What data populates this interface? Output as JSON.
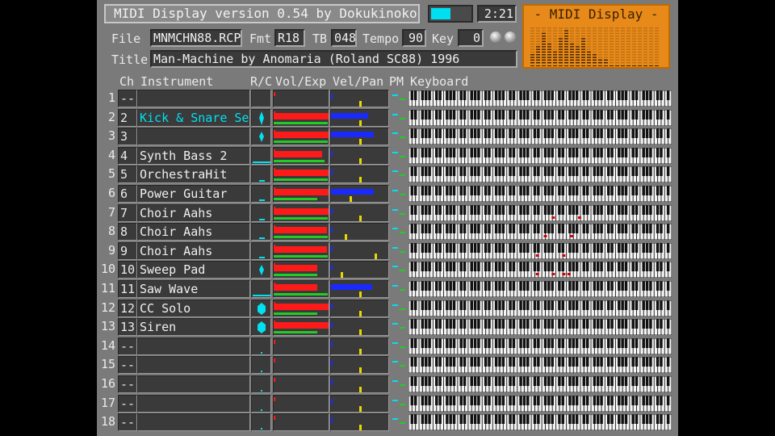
{
  "header": {
    "title": "MIDI Display  version 0.54  by Dokukinoko",
    "time": "2:21",
    "file_label": "File",
    "file": "MNMCHN88.RCP",
    "fmt_label": "Fmt",
    "fmt": "R18",
    "tb_label": "TB",
    "tb": "048",
    "tempo_label": "Tempo",
    "tempo": "90",
    "key_label": "Key",
    "key": "0",
    "title_label": "Title",
    "song_title": "Man-Machine by Anomaria (Roland SC88) 1996"
  },
  "logo": {
    "text": "- MIDI Display -"
  },
  "columns": {
    "ch": "Ch",
    "instrument": "Instrument",
    "rc": "R/C",
    "volexp": "Vol/Exp",
    "velpan": "Vel/Pan",
    "pm": "PM",
    "keyboard": "Keyboard"
  },
  "colors": {
    "accent_cyan": "#00e0f0",
    "volume": "#ff1a1a",
    "expression": "#22cc22",
    "velocity": "#1a2aff",
    "pan": "#e8d800",
    "note": "#d00000"
  },
  "channels": [
    {
      "row": "1",
      "num": "--",
      "name": "",
      "vol": 0,
      "exp": 0,
      "vel": 0,
      "pan": 0.5,
      "rc": "none",
      "active": false,
      "notes": []
    },
    {
      "row": "2",
      "num": "2",
      "name": "Kick & Snare Se",
      "vol": 1.0,
      "exp": 0.98,
      "vel": 0.65,
      "pan": 0.5,
      "rc": "long",
      "active": true,
      "notes": []
    },
    {
      "row": "3",
      "num": "3",
      "name": "",
      "vol": 1.0,
      "exp": 0.98,
      "vel": 0.75,
      "pan": 0.5,
      "rc": "mid",
      "active": false,
      "notes": []
    },
    {
      "row": "4",
      "num": "4",
      "name": "Synth Bass 2",
      "vol": 0.88,
      "exp": 0.92,
      "vel": 0.03,
      "pan": 0.5,
      "rc": "flat",
      "active": false,
      "notes": []
    },
    {
      "row": "5",
      "num": "5",
      "name": "OrchestraHit",
      "vol": 1.0,
      "exp": 0.98,
      "vel": 0.03,
      "pan": 0.5,
      "rc": "tick",
      "active": false,
      "notes": []
    },
    {
      "row": "6",
      "num": "6",
      "name": "Power Guitar",
      "vol": 1.0,
      "exp": 0.8,
      "vel": 0.75,
      "pan": 0.33,
      "rc": "tick",
      "active": false,
      "notes": []
    },
    {
      "row": "7",
      "num": "7",
      "name": "Choir Aahs",
      "vol": 1.0,
      "exp": 0.98,
      "vel": 0.03,
      "pan": 0.5,
      "rc": "tick",
      "active": false,
      "notes": [
        0.55,
        0.65
      ]
    },
    {
      "row": "8",
      "num": "8",
      "name": "Choir Aahs",
      "vol": 0.97,
      "exp": 0.98,
      "vel": 0.03,
      "pan": 0.25,
      "rc": "tick",
      "active": false,
      "notes": [
        0.52,
        0.62
      ]
    },
    {
      "row": "9",
      "num": "9",
      "name": "Choir Aahs",
      "vol": 0.97,
      "exp": 0.98,
      "vel": 0.03,
      "pan": 0.78,
      "rc": "tick",
      "active": false,
      "notes": [
        0.49,
        0.59
      ]
    },
    {
      "row": "10",
      "num": "10",
      "name": "Sweep Pad",
      "vol": 0.8,
      "exp": 0.8,
      "vel": 0.02,
      "pan": 0.17,
      "rc": "mid",
      "active": false,
      "notes": [
        0.49,
        0.55,
        0.59,
        0.61
      ]
    },
    {
      "row": "11",
      "num": "11",
      "name": "Saw Wave",
      "vol": 0.8,
      "exp": 0.98,
      "vel": 0.72,
      "pan": 0.5,
      "rc": "flat",
      "active": false,
      "notes": []
    },
    {
      "row": "12",
      "num": "12",
      "name": "CC Solo",
      "vol": 1.0,
      "exp": 0.8,
      "vel": 0.02,
      "pan": 0.5,
      "rc": "big",
      "active": false,
      "notes": []
    },
    {
      "row": "13",
      "num": "13",
      "name": "Siren",
      "vol": 1.0,
      "exp": 0.8,
      "vel": 0.0,
      "pan": 0.5,
      "rc": "big",
      "active": false,
      "notes": []
    },
    {
      "row": "14",
      "num": "--",
      "name": "",
      "vol": 0,
      "exp": 0,
      "vel": 0,
      "pan": 0.5,
      "rc": "dot",
      "active": false,
      "notes": []
    },
    {
      "row": "15",
      "num": "--",
      "name": "",
      "vol": 0,
      "exp": 0,
      "vel": 0,
      "pan": 0.5,
      "rc": "dot",
      "active": false,
      "notes": []
    },
    {
      "row": "16",
      "num": "--",
      "name": "",
      "vol": 0,
      "exp": 0,
      "vel": 0,
      "pan": 0.5,
      "rc": "dot",
      "active": false,
      "notes": []
    },
    {
      "row": "17",
      "num": "--",
      "name": "",
      "vol": 0,
      "exp": 0,
      "vel": 0,
      "pan": 0.5,
      "rc": "dot",
      "active": false,
      "notes": []
    },
    {
      "row": "18",
      "num": "--",
      "name": "",
      "vol": 0,
      "exp": 0,
      "vel": 0,
      "pan": 0.5,
      "rc": "dot",
      "active": false,
      "notes": []
    }
  ]
}
